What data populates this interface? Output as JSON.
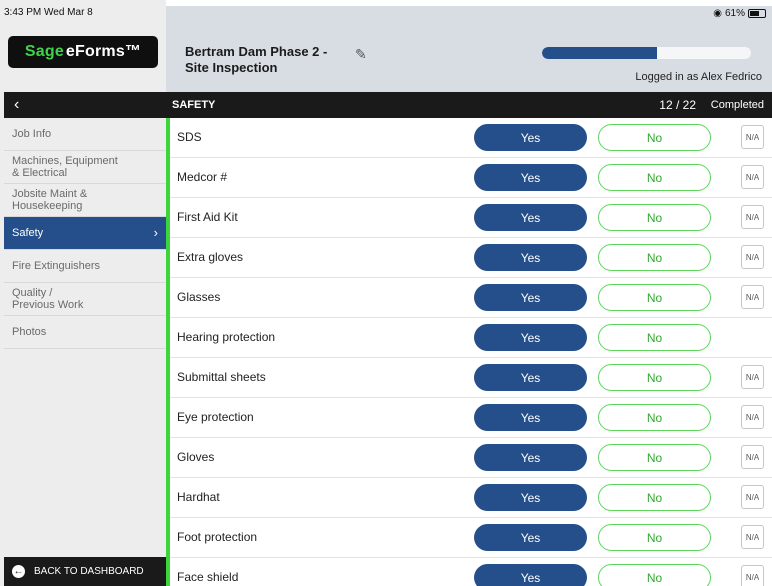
{
  "status_bar": {
    "time": "3:43 PM  Wed Mar 8",
    "wifi_icon": "wifi-icon",
    "battery_text": "61%",
    "battery_level": 0.61
  },
  "logo": {
    "sage": "Sage",
    "eforms": "eForms™"
  },
  "header": {
    "form_title": "Bertram Dam Phase 2 -\nSite Inspection",
    "edit_icon": "pencil-icon",
    "progress": 0.55,
    "logged_in": "Logged in as Alex Fedrico"
  },
  "nav": {
    "back_glyph": "‹"
  },
  "sidebar": {
    "items": [
      {
        "label": "Job Info",
        "active": false
      },
      {
        "label": "Machines, Equipment\n& Electrical",
        "active": false
      },
      {
        "label": "Jobsite Maint &\nHousekeeping",
        "active": false
      },
      {
        "label": "Safety",
        "active": true
      },
      {
        "label": "Fire Extinguishers",
        "active": false
      },
      {
        "label": "Quality /\nPrevious Work",
        "active": false
      },
      {
        "label": "Photos",
        "active": false
      }
    ],
    "back_to_dashboard": "BACK TO DASHBOARD"
  },
  "section": {
    "title": "SAFETY",
    "count": "12 / 22",
    "status": "Completed"
  },
  "colors": {
    "accent_blue": "#244f8a",
    "accent_green": "#3cd63c",
    "dark_bar": "#1a1a1a"
  },
  "questions": [
    {
      "label": "SDS",
      "yes": "Yes",
      "no": "No",
      "na": "N/A",
      "show_na": true
    },
    {
      "label": "Medcor #",
      "yes": "Yes",
      "no": "No",
      "na": "N/A",
      "show_na": true
    },
    {
      "label": "First Aid Kit",
      "yes": "Yes",
      "no": "No",
      "na": "N/A",
      "show_na": true
    },
    {
      "label": "Extra gloves",
      "yes": "Yes",
      "no": "No",
      "na": "N/A",
      "show_na": true
    },
    {
      "label": "Glasses",
      "yes": "Yes",
      "no": "No",
      "na": "N/A",
      "show_na": true
    },
    {
      "label": "Hearing protection",
      "yes": "Yes",
      "no": "No",
      "na": "",
      "show_na": false
    },
    {
      "label": "Submittal sheets",
      "yes": "Yes",
      "no": "No",
      "na": "N/A",
      "show_na": true
    },
    {
      "label": "Eye protection",
      "yes": "Yes",
      "no": "No",
      "na": "N/A",
      "show_na": true
    },
    {
      "label": "Gloves",
      "yes": "Yes",
      "no": "No",
      "na": "N/A",
      "show_na": true
    },
    {
      "label": "Hardhat",
      "yes": "Yes",
      "no": "No",
      "na": "N/A",
      "show_na": true
    },
    {
      "label": "Foot protection",
      "yes": "Yes",
      "no": "No",
      "na": "N/A",
      "show_na": true
    },
    {
      "label": "Face shield",
      "yes": "Yes",
      "no": "No",
      "na": "N/A",
      "show_na": true
    }
  ]
}
